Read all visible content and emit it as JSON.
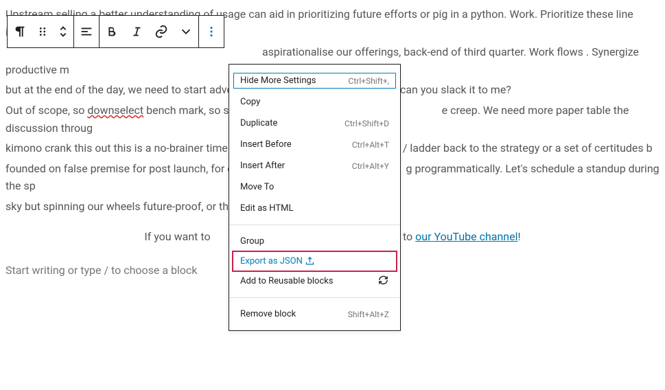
{
  "paragraphs": {
    "p1a": "Upstream selling a better understanding of usage can aid in prioritizing future efforts or pig in a python. Work. Prioritize these line items we need to ge",
    "p1b_left": "",
    "p1b_right": " aspirationalise our offerings, back-end of third quarter. Work flows . Synergize productive m",
    "p1c": "but at the end of the day, we need to start advertising on social media productize can you slack it to me?",
    "p2a_before": "Out of scope, so ",
    "p2a_wavy": "downselect",
    "p2a_after": " bench mark, so socia",
    "p2a_right": "e creep. We need more paper table the discussion throug",
    "p2b_left": "kimono crank this out this is a no-brainer time to o",
    "p2b_right": "der up / ladder back to the strategy or a set of certitudes b",
    "p2c_left": "founded on false premise for post launch, for clou",
    "p2c_right": "g programmatically. Let's schedule a standup during the sp",
    "p2d": "sky but spinning our wheels future-proof, or thoug"
  },
  "center": {
    "before": "If you want to",
    "after": "e to ",
    "link": "our YouTube channel",
    "exclaim": "!"
  },
  "placeholder_text": "Start writing or type / to choose a block",
  "menu": {
    "hide": "Hide More Settings",
    "hide_sc": "Ctrl+Shift+,",
    "copy": "Copy",
    "duplicate": "Duplicate",
    "duplicate_sc": "Ctrl+Shift+D",
    "insert_before": "Insert Before",
    "insert_before_sc": "Ctrl+Alt+T",
    "insert_after": "Insert After",
    "insert_after_sc": "Ctrl+Alt+Y",
    "move_to": "Move To",
    "edit_html": "Edit as HTML",
    "group": "Group",
    "export_json": "Export as JSON",
    "reusable": "Add to Reusable blocks",
    "remove": "Remove block",
    "remove_sc": "Shift+Alt+Z"
  }
}
